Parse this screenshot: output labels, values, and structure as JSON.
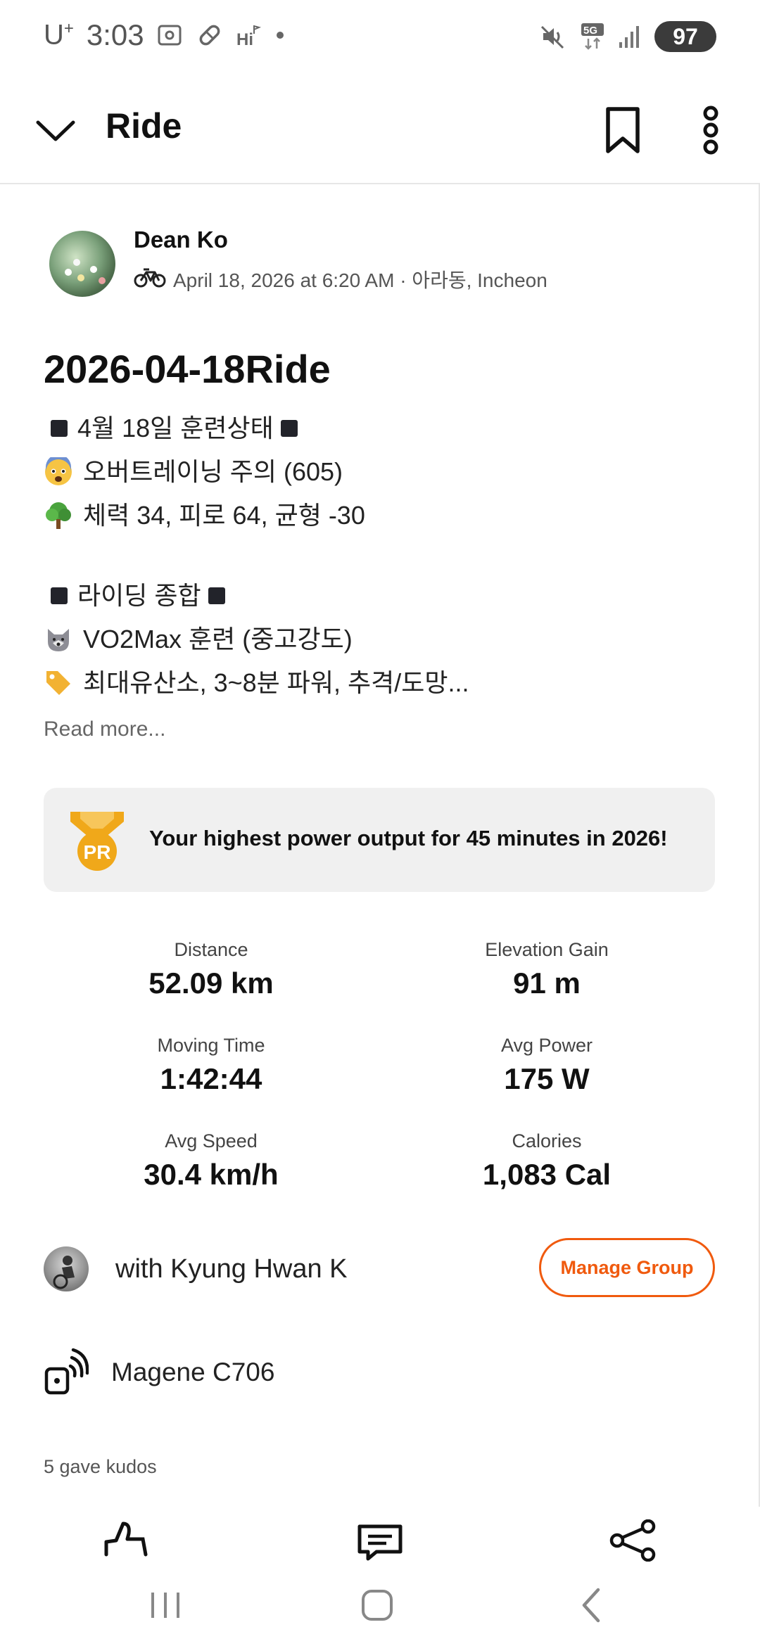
{
  "status_bar": {
    "carrier": "U",
    "carrier_sup": "+",
    "time": "3:03",
    "battery": "97",
    "network": "5G"
  },
  "app_bar": {
    "title": "Ride"
  },
  "athlete": {
    "name": "Dean Ko",
    "meta": "April 18, 2026 at 6:20 AM · 아라동, Incheon"
  },
  "activity": {
    "title": "2026-04-18Ride",
    "description": {
      "line1": "4월 18일 훈련상태",
      "line2": "오버트레이닝 주의 (605)",
      "line3": "체력 34, 피로 64, 균형 -30",
      "line4": "라이딩 종합",
      "line5": "VO2Max 훈련 (중고강도)",
      "line6": "최대유산소, 3~8분 파워, 추격/도망..."
    },
    "read_more": "Read more..."
  },
  "achievement": {
    "badge": "PR",
    "text": "Your highest power output for 45 minutes in 2026!"
  },
  "stats": [
    {
      "label": "Distance",
      "value": "52.09 km"
    },
    {
      "label": "Elevation Gain",
      "value": "91 m"
    },
    {
      "label": "Moving Time",
      "value": "1:42:44"
    },
    {
      "label": "Avg Power",
      "value": "175 W"
    },
    {
      "label": "Avg Speed",
      "value": "30.4 km/h"
    },
    {
      "label": "Calories",
      "value": "1,083 Cal"
    }
  ],
  "group": {
    "text": "with Kyung Hwan K",
    "button": "Manage Group"
  },
  "device": {
    "name": "Magene C706"
  },
  "kudos": {
    "text": "5 gave kudos"
  },
  "colors": {
    "accent": "#f05a0e",
    "pr_gold": "#f0a81a",
    "card_bg": "#f0f0f0"
  }
}
